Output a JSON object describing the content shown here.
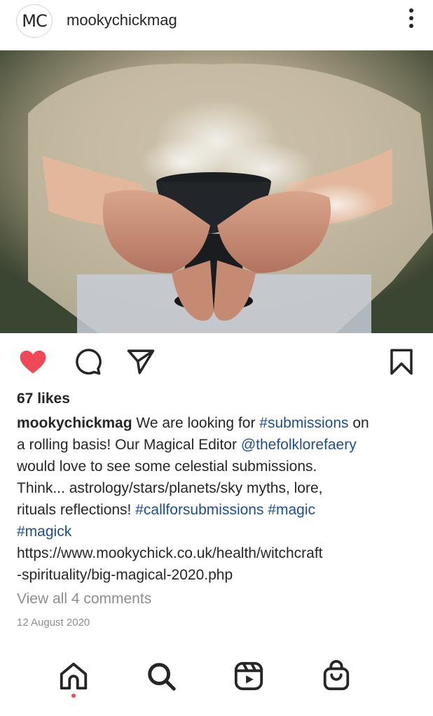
{
  "post": {
    "avatar_text": "MC",
    "username": "mookychickmag",
    "likes": "67 likes",
    "caption": {
      "username": "mookychickmag",
      "t1": " We are looking for ",
      "tag_submissions": "#submissions",
      "t2": " on",
      "t3": "a rolling basis! Our Magical Editor ",
      "mention": "@thefolklorefaery",
      "t4": "would love to see some celestial submissions.",
      "t5": "Think... astrology/stars/planets/sky myths, lore,",
      "t6": "rituals reflections! ",
      "tag_call": "#callforsubmissions",
      "t7": " ",
      "tag_magic": "#magic",
      "tag_magick": "#magick",
      "url1": "https://www.mookychick.co.uk/health/witchcraft",
      "url2": "-spirituality/big-magical-2020.php"
    },
    "comments_link": "View all 4 comments",
    "date": "12 August 2020"
  },
  "colors": {
    "like_red": "#ed4956",
    "hashtag_blue": "#1f4f8a",
    "text": "#262626",
    "muted": "#8e8e8e"
  },
  "icons": {
    "more": "more-vertical-icon",
    "like": "heart-filled-icon",
    "comment": "comment-bubble-icon",
    "share": "paper-plane-icon",
    "save": "bookmark-icon",
    "home": "home-icon",
    "search": "search-icon",
    "reels": "reels-icon",
    "shop": "shop-bag-icon"
  }
}
